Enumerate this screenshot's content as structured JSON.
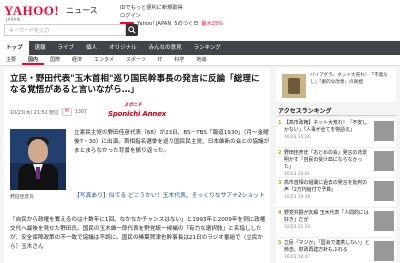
{
  "header": {
    "logo_text": "YAHOO!",
    "logo_sub": "JAPAN",
    "section": "ニュース",
    "promo_line1": "IDでもっと便利に新規取得",
    "promo_line2": "ログイン",
    "promo_line3_a": "Yahoo! JAPAN",
    "promo_line3_b": "5のつく日",
    "promo_line3_c": "最大25%",
    "search_placeholder": "キーワードを入力"
  },
  "nav": [
    "トップ",
    "速報",
    "ライブ",
    "個人",
    "オリジナル",
    "みんなの意見",
    "ランキング"
  ],
  "subnav": [
    "主要",
    "国内",
    "国際",
    "経済",
    "エンタメ",
    "スポーツ",
    "IT",
    "科学",
    "地域"
  ],
  "article": {
    "title": "立民・野田代表\"玉木首相\"巡り国民幹事長の発言に反論「総理になる覚悟があると言いながら…」",
    "date": "10/23(木) 21:52 配信",
    "comments": "1367",
    "brand_top": "スポニチ",
    "brand_main": "Sponichi Annex",
    "photo_caption": "野田佳彦氏",
    "lead": "立憲民主党の野田佳彦代表（68）が23日、BS－TBS「報道1930」（月～金曜後7・30）に出演。首相指名選挙を巡り国民民主党、日本維新の会との協議がまとまらなかった背景を振り返った。",
    "link": "【写真あり】似てる どこうかい！玉木代表、そっくりなサアナ2ショット",
    "body": "「自民から政権を奪えるのは十数年に1回。なかなかチャンスはない」と1993年と2009年を例に政権交代へ最後を見せた野田氏。国民の玉木雄一郎代表を野党統一候補の「有力な選択肢」と名指ししたが、安全保障政策の不一致で協議は不調に。国民の榛葉賀津也幹事長は21日のラジオ番組で（立民から）玉木さん"
  },
  "sidebar": {
    "ad_text": "バイアグラ、ネット大売れ！「不発なし」「劇的な改善」の真相",
    "ranking_title": "アクセスランキング",
    "ranking": [
      {
        "num": "1",
        "text": "【高市政権】ネット大荒れ！「不安しかない」「人事が全てを物語る」",
        "date": "10/23 14:26"
      },
      {
        "num": "2",
        "text": "野田佳彦氏「おどめの会」発言の背景明かす「自民の受け皿にならなかった」",
        "date": "10/23 20:01"
      },
      {
        "num": "3",
        "text": "高市首相の組閣に過去の発言を批判の声「2万円給付で予算」",
        "date": "10/23 19:38"
      },
      {
        "num": "4",
        "text": "野党共闘が瓦解 玉木代表「人間的には好き」だが",
        "date": "10/23 21:20"
      },
      {
        "num": "5",
        "text": "立民「マジか」「国会で連携しない」と懸念、財政再建方針もぶれる",
        "date": "10/23 18:47"
      }
    ]
  }
}
